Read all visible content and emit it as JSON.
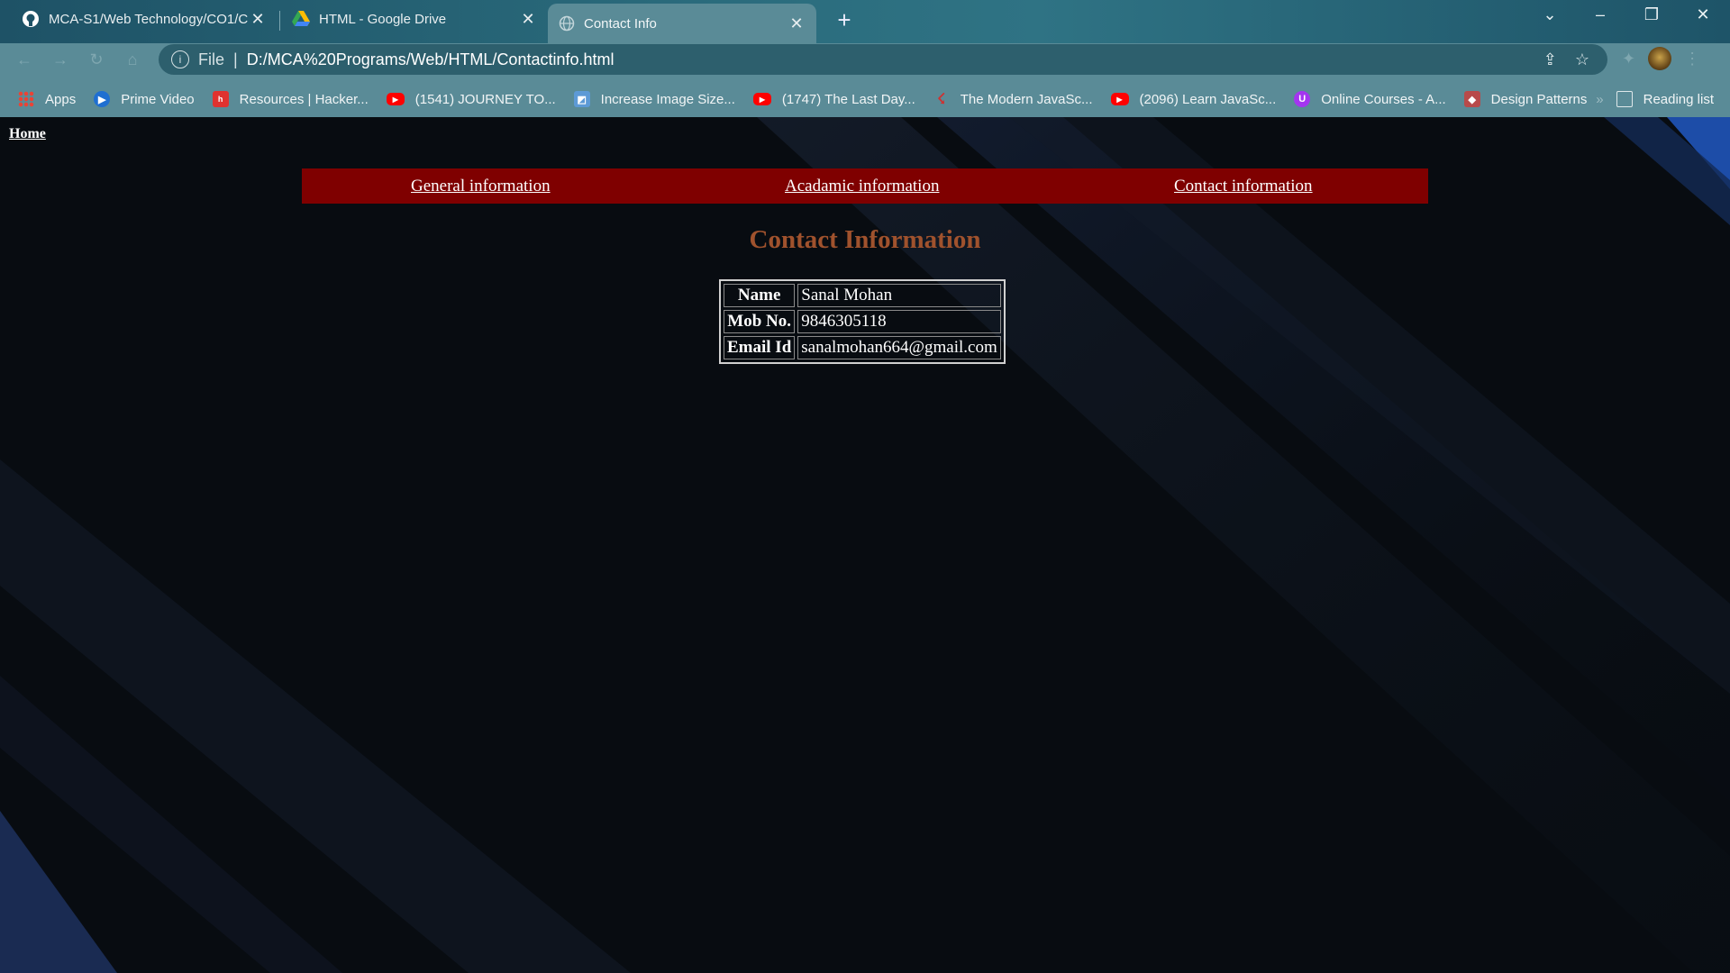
{
  "browser": {
    "tabs": [
      {
        "title": "MCA-S1/Web Technology/CO1/C",
        "icon": "github-icon"
      },
      {
        "title": "HTML - Google Drive",
        "icon": "google-drive-icon"
      },
      {
        "title": "Contact Info",
        "icon": "globe-icon",
        "active": true
      }
    ],
    "address": {
      "scheme": "File",
      "url": "D:/MCA%20Programs/Web/HTML/Contactinfo.html"
    },
    "bookmarks": [
      {
        "label": "Apps",
        "icon": "apps-grid-icon"
      },
      {
        "label": "Prime Video",
        "icon": "prime-video-icon"
      },
      {
        "label": "Resources | Hacker...",
        "icon": "hackerrank-icon"
      },
      {
        "label": "(1541) JOURNEY TO...",
        "icon": "youtube-icon"
      },
      {
        "label": "Increase Image Size...",
        "icon": "image-icon"
      },
      {
        "label": "(1747) The Last Day...",
        "icon": "youtube-icon"
      },
      {
        "label": "The Modern JavaSc...",
        "icon": "modern-js-icon"
      },
      {
        "label": "(2096) Learn JavaSc...",
        "icon": "youtube-icon"
      },
      {
        "label": "Online Courses - A...",
        "icon": "udemy-icon"
      },
      {
        "label": "Design Patterns",
        "icon": "design-patterns-icon"
      }
    ],
    "reading_list": "Reading list"
  },
  "page": {
    "home_link": "Home",
    "nav": {
      "general": "General information",
      "academic": "Acadamic information",
      "contact": "Contact information"
    },
    "heading": "Contact Information",
    "table": {
      "rows": [
        {
          "label": "Name",
          "value": "Sanal Mohan"
        },
        {
          "label": "Mob No.",
          "value": "9846305118"
        },
        {
          "label": "Email Id",
          "value": "sanalmohan664@gmail.com"
        }
      ]
    }
  },
  "colors": {
    "nav_bar": "#7f0000",
    "heading": "#a0522d",
    "page_bg": "#080c11"
  }
}
